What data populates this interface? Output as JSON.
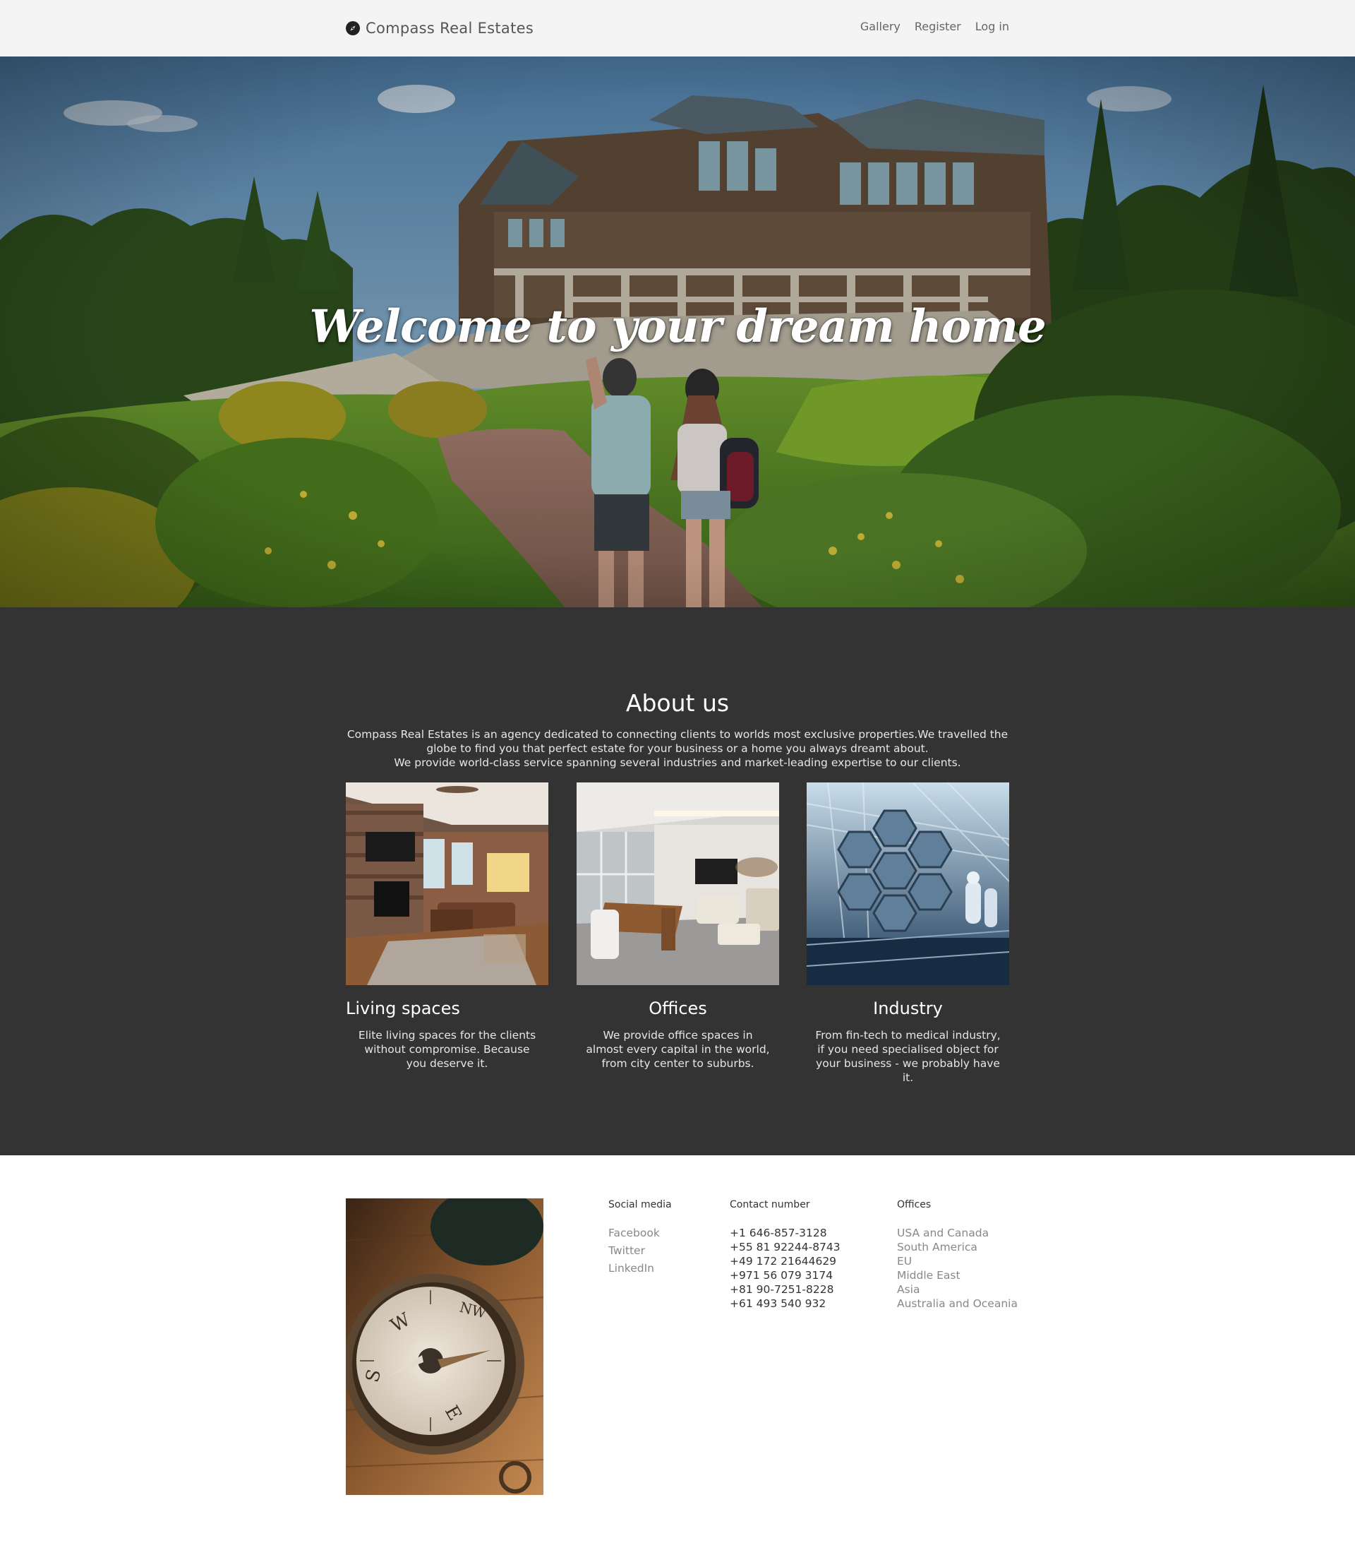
{
  "nav": {
    "brand": "Compass Real Estates",
    "links": [
      "Gallery",
      "Register",
      "Log in"
    ]
  },
  "hero": {
    "title": "Welcome to your dream home"
  },
  "about": {
    "title": "About us",
    "description_line1": "Compass Real Estates is an agency dedicated to connecting clients to worlds most exclusive properties.We travelled the globe to find you that perfect estate for your business or a home you always dreamt about.",
    "description_line2": "We provide world-class service spanning several industries and market-leading expertise to our clients.",
    "cards": [
      {
        "title": "Living spaces",
        "text": "Elite living spaces for the clients without compromise. Because you deserve it."
      },
      {
        "title": "Offices",
        "text": "We provide office spaces in almost every capital in the world, from city center to suburbs."
      },
      {
        "title": "Industry",
        "text": "From fin-tech to medical industry, if you need specialised object for your business - we probably have it."
      }
    ]
  },
  "footer": {
    "social": {
      "title": "Social media",
      "items": [
        "Facebook",
        "Twitter",
        "LinkedIn"
      ]
    },
    "contact": {
      "title": "Contact number",
      "items": [
        "+1 646-857-3128",
        "+55 81 92244-8743",
        "+49 172 21644629",
        "+971 56 079 3174",
        "+81 90-7251-8228",
        "+61 493 540 932"
      ]
    },
    "offices": {
      "title": "Offices",
      "items": [
        "USA and Canada",
        "South America",
        "EU",
        "Middle East",
        "Asia",
        "Australia and Oceania"
      ]
    }
  },
  "colors": {
    "nav_bg": "#f4f4f4",
    "about_bg": "#333333",
    "footer_bg": "#ffffff"
  }
}
